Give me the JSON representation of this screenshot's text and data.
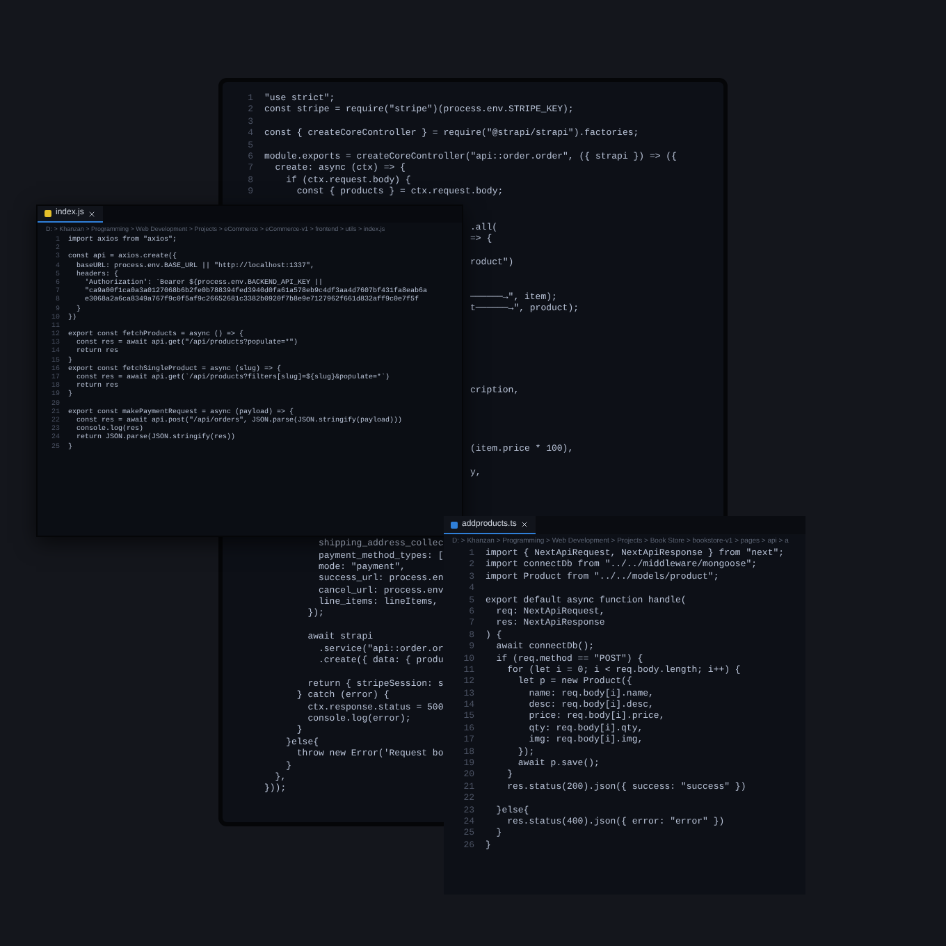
{
  "back_editor": {
    "top_lines": [
      {
        "kind": "code",
        "n": "1",
        "text": "\"use strict\";"
      },
      {
        "kind": "code",
        "n": "2",
        "text": "const stripe = require(\"stripe\")(process.env.STRIPE_KEY);"
      },
      {
        "kind": "blank",
        "n": "3"
      },
      {
        "kind": "code",
        "n": "4",
        "text": "const { createCoreController } = require(\"@strapi/strapi\").factories;"
      },
      {
        "kind": "blank",
        "n": "5"
      },
      {
        "kind": "code",
        "n": "6",
        "text": "module.exports = createCoreController(\"api::order.order\", ({ strapi }) => ({"
      },
      {
        "kind": "code",
        "n": "7",
        "text": "  create: async (ctx) => {"
      },
      {
        "kind": "code",
        "n": "8",
        "text": "    if (ctx.request.body) {"
      },
      {
        "kind": "code",
        "n": "9",
        "text": "      const { products } = ctx.request.body;"
      }
    ],
    "right_fragments": [
      {
        "kind": "code",
        "text": ".all("
      },
      {
        "kind": "code",
        "text": "=> {"
      },
      {
        "kind": "blank"
      },
      {
        "kind": "code",
        "text": "roduct\")"
      },
      {
        "kind": "blank"
      },
      {
        "kind": "blank"
      },
      {
        "kind": "code",
        "text": "──────→\", item);"
      },
      {
        "kind": "code",
        "text": "t──────→\", product);"
      },
      {
        "kind": "blank"
      },
      {
        "kind": "blank"
      },
      {
        "kind": "blank"
      },
      {
        "kind": "blank"
      },
      {
        "kind": "blank"
      },
      {
        "kind": "blank"
      },
      {
        "kind": "code",
        "text": "cription,"
      },
      {
        "kind": "blank"
      },
      {
        "kind": "blank"
      },
      {
        "kind": "blank"
      },
      {
        "kind": "blank"
      },
      {
        "kind": "code",
        "text": "(item.price * 100),"
      },
      {
        "kind": "blank"
      },
      {
        "kind": "code",
        "text": "y,"
      }
    ],
    "bottom_lines": [
      {
        "kind": "code",
        "text": "          shipping_address_collec"
      },
      {
        "kind": "code",
        "text": "          payment_method_types: ["
      },
      {
        "kind": "code",
        "text": "          mode: \"payment\","
      },
      {
        "kind": "code",
        "text": "          success_url: process.en"
      },
      {
        "kind": "code",
        "text": "          cancel_url: process.env"
      },
      {
        "kind": "code",
        "text": "          line_items: lineItems,"
      },
      {
        "kind": "code",
        "text": "        });"
      },
      {
        "kind": "blank"
      },
      {
        "kind": "code",
        "text": "        await strapi"
      },
      {
        "kind": "code",
        "text": "          .service(\"api::order.or"
      },
      {
        "kind": "code",
        "text": "          .create({ data: { produ"
      },
      {
        "kind": "blank"
      },
      {
        "kind": "code",
        "text": "        return { stripeSession: s"
      },
      {
        "kind": "code",
        "text": "      } catch (error) {"
      },
      {
        "kind": "code",
        "text": "        ctx.response.status = 500"
      },
      {
        "kind": "code",
        "text": "        console.log(error);"
      },
      {
        "kind": "code",
        "text": "      }"
      },
      {
        "kind": "code",
        "text": "    }else{"
      },
      {
        "kind": "code",
        "text": "      throw new Error('Request bo"
      },
      {
        "kind": "code",
        "text": "    }"
      },
      {
        "kind": "code",
        "text": "  },"
      },
      {
        "kind": "code",
        "text": "}));"
      }
    ]
  },
  "index_editor": {
    "tab": "index.js",
    "breadcrumb": "D: > Khanzan > Programming > Web Development > Projects > eCommerce > eCommerce-v1 > frontend > utils > index.js",
    "lines": [
      {
        "kind": "code",
        "n": "1",
        "text": "import axios from \"axios\";"
      },
      {
        "kind": "blank",
        "n": "2"
      },
      {
        "kind": "code",
        "n": "3",
        "text": "const api = axios.create({"
      },
      {
        "kind": "code",
        "n": "4",
        "text": "  baseURL: process.env.BASE_URL || \"http://localhost:1337\","
      },
      {
        "kind": "code",
        "n": "5",
        "text": "  headers: {"
      },
      {
        "kind": "code",
        "n": "6",
        "text": "    'Authorization': `Bearer ${process.env.BACKEND_API_KEY ||"
      },
      {
        "kind": "code",
        "n": "7",
        "text": "    \"ca9a00f1ca0a3a0127068b6b2fe0b788394fed3940d0fa61a578eb9c4df3aa4d7607bf431fa8eab6a"
      },
      {
        "kind": "code",
        "n": "8",
        "text": "    e3068a2a6ca8349a767f9c0f5af9c26652681c3382b0920f7b8e9e7127962f661d832aff9c0e7f5f"
      },
      {
        "kind": "code",
        "n": "9",
        "text": "  }"
      },
      {
        "kind": "code",
        "n": "10",
        "text": "})"
      },
      {
        "kind": "blank",
        "n": "11"
      },
      {
        "kind": "code",
        "n": "12",
        "text": "export const fetchProducts = async () => {"
      },
      {
        "kind": "code",
        "n": "13",
        "text": "  const res = await api.get(\"/api/products?populate=*\")"
      },
      {
        "kind": "code",
        "n": "14",
        "text": "  return res"
      },
      {
        "kind": "code",
        "n": "15",
        "text": "}"
      },
      {
        "kind": "code",
        "n": "16",
        "text": "export const fetchSingleProduct = async (slug) => {"
      },
      {
        "kind": "code",
        "n": "17",
        "text": "  const res = await api.get(`/api/products?filters[slug]=${slug}&populate=*`)"
      },
      {
        "kind": "code",
        "n": "18",
        "text": "  return res"
      },
      {
        "kind": "code",
        "n": "19",
        "text": "}"
      },
      {
        "kind": "blank",
        "n": "20"
      },
      {
        "kind": "code",
        "n": "21",
        "text": "export const makePaymentRequest = async (payload) => {"
      },
      {
        "kind": "code",
        "n": "22",
        "text": "  const res = await api.post(\"/api/orders\", JSON.parse(JSON.stringify(payload)))"
      },
      {
        "kind": "code",
        "n": "23",
        "text": "  console.log(res)"
      },
      {
        "kind": "code",
        "n": "24",
        "text": "  return JSON.parse(JSON.stringify(res))"
      },
      {
        "kind": "code",
        "n": "25",
        "text": "}"
      }
    ]
  },
  "addproducts_editor": {
    "tab": "addproducts.ts",
    "breadcrumb": "D: > Khanzan > Programming > Web Development > Projects > Book Store > bookstore-v1 > pages > api > a",
    "lines": [
      {
        "kind": "code",
        "n": "1",
        "text": "import { NextApiRequest, NextApiResponse } from \"next\";"
      },
      {
        "kind": "code",
        "n": "2",
        "text": "import connectDb from \"../../middleware/mongoose\";"
      },
      {
        "kind": "code",
        "n": "3",
        "text": "import Product from \"../../models/product\";"
      },
      {
        "kind": "blank",
        "n": "4"
      },
      {
        "kind": "code",
        "n": "5",
        "text": "export default async function handle("
      },
      {
        "kind": "code",
        "n": "6",
        "text": "  req: NextApiRequest,"
      },
      {
        "kind": "code",
        "n": "7",
        "text": "  res: NextApiResponse"
      },
      {
        "kind": "code",
        "n": "8",
        "text": ") {"
      },
      {
        "kind": "code",
        "n": "9",
        "text": "  await connectDb();"
      },
      {
        "kind": "code",
        "n": "10",
        "text": "  if (req.method == \"POST\") {"
      },
      {
        "kind": "code",
        "n": "11",
        "text": "    for (let i = 0; i < req.body.length; i++) {"
      },
      {
        "kind": "code",
        "n": "12",
        "text": "      let p = new Product({"
      },
      {
        "kind": "code",
        "n": "13",
        "text": "        name: req.body[i].name,"
      },
      {
        "kind": "code",
        "n": "14",
        "text": "        desc: req.body[i].desc,"
      },
      {
        "kind": "code",
        "n": "15",
        "text": "        price: req.body[i].price,"
      },
      {
        "kind": "code",
        "n": "16",
        "text": "        qty: req.body[i].qty,"
      },
      {
        "kind": "code",
        "n": "17",
        "text": "        img: req.body[i].img,"
      },
      {
        "kind": "code",
        "n": "18",
        "text": "      });"
      },
      {
        "kind": "code",
        "n": "19",
        "text": "      await p.save();"
      },
      {
        "kind": "code",
        "n": "20",
        "text": "    }"
      },
      {
        "kind": "code",
        "n": "21",
        "text": "    res.status(200).json({ success: \"success\" })"
      },
      {
        "kind": "blank",
        "n": "22"
      },
      {
        "kind": "code",
        "n": "23",
        "text": "  }else{"
      },
      {
        "kind": "code",
        "n": "24",
        "text": "    res.status(400).json({ error: \"error\" })"
      },
      {
        "kind": "code",
        "n": "25",
        "text": "  }"
      },
      {
        "kind": "code",
        "n": "26",
        "text": "}"
      }
    ]
  }
}
